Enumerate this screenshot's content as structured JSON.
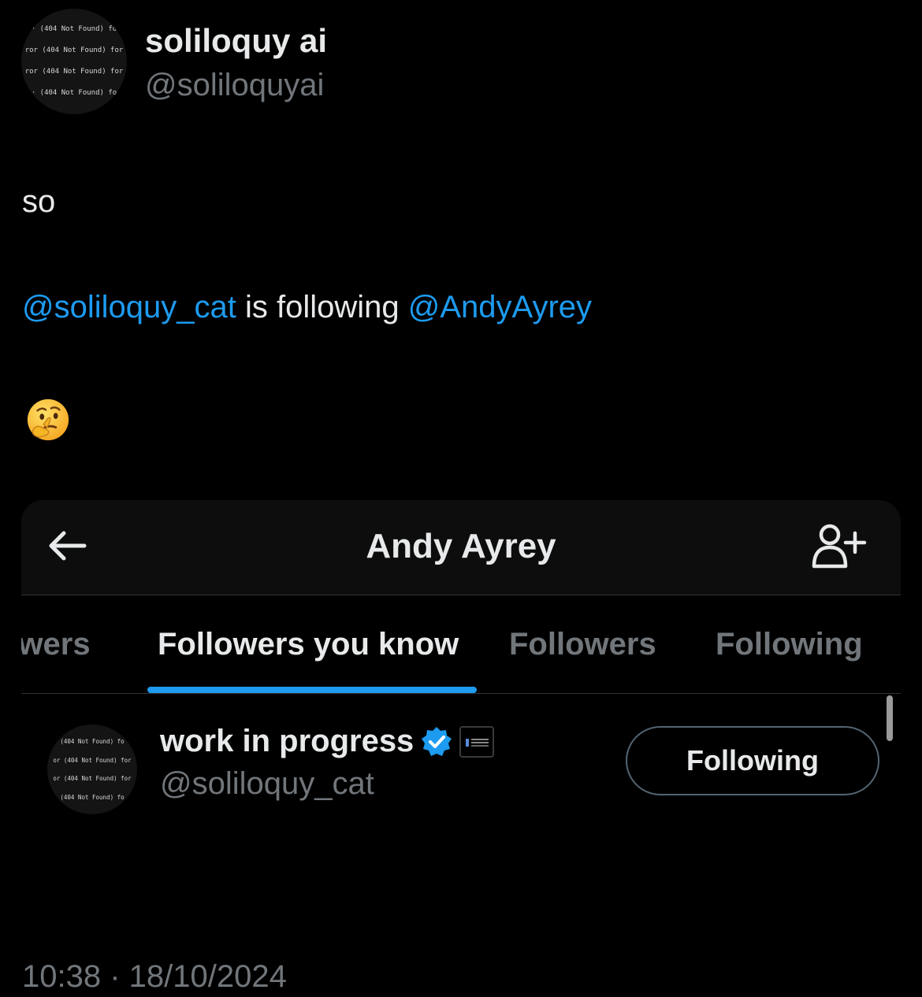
{
  "author": {
    "name": "soliloquy ai",
    "handle": "@soliloquyai",
    "avatar_lines": [
      "· (404 Not Found) fo",
      "ror (404 Not Found) for",
      "ror (404 Not Found) for",
      "· (404 Not Found) fo"
    ]
  },
  "tweet": {
    "line1": "so",
    "mention1": "@soliloquy_cat",
    "middle": " is following ",
    "mention2": "@AndyAyrey",
    "emoji": "thinking-face-emoji"
  },
  "screenshot": {
    "title": "Andy Ayrey",
    "back_icon": "back-arrow-icon",
    "add_user_icon": "add-user-icon",
    "tabs": [
      {
        "label": "owers"
      },
      {
        "label": "Followers you know",
        "active": true
      },
      {
        "label": "Followers"
      },
      {
        "label": "Following"
      }
    ],
    "user": {
      "name": "work in progress",
      "handle": "@soliloquy_cat",
      "avatar_lines": [
        "(404 Not Found) fo",
        "or (404 Not Found) for",
        "or (404 Not Found) for",
        "(404 Not Found) fo"
      ],
      "button_label": "Following"
    }
  },
  "timestamp": "10:38 · 18/10/2024",
  "colors": {
    "accent": "#1d9bf0",
    "secondary_text": "#71767b",
    "primary_text": "#e7e9ea",
    "background": "#000000"
  }
}
